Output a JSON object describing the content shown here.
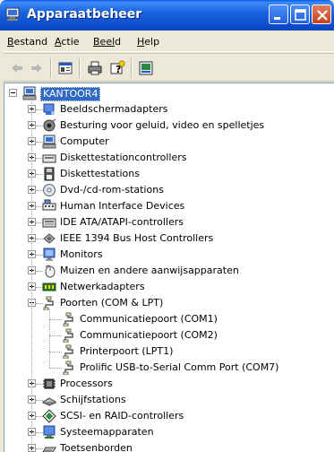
{
  "window": {
    "title": "Apparaatbeheer"
  },
  "menu": {
    "items": [
      {
        "label": "Bestand",
        "underline": "B",
        "rest": "estand"
      },
      {
        "label": "Actie",
        "underline": "A",
        "rest": "ctie"
      },
      {
        "label": "Beeld",
        "underline": "Beel",
        "rest": "d"
      },
      {
        "label": "Help",
        "underline": "H",
        "rest": "elp"
      }
    ]
  },
  "toolbar": {
    "buttons": [
      "back-icon",
      "forward-icon",
      "properties-icon",
      "print-icon",
      "help-icon",
      "update-driver-icon"
    ]
  },
  "tree": {
    "root": {
      "label": "KANTOOR4",
      "icon": "computer-icon",
      "expanded": true
    },
    "categories": [
      {
        "label": "Beeldschermadapters",
        "icon": "display-adapter-icon"
      },
      {
        "label": "Besturing voor geluid, video en spelletjes",
        "icon": "sound-icon"
      },
      {
        "label": "Computer",
        "icon": "computer-icon"
      },
      {
        "label": "Diskettestationcontrollers",
        "icon": "floppy-controller-icon"
      },
      {
        "label": "Diskettestations",
        "icon": "floppy-drive-icon"
      },
      {
        "label": "Dvd-/cd-rom-stations",
        "icon": "cdrom-icon"
      },
      {
        "label": "Human Interface Devices",
        "icon": "hid-icon"
      },
      {
        "label": "IDE ATA/ATAPI-controllers",
        "icon": "ide-controller-icon"
      },
      {
        "label": "IEEE 1394 Bus Host Controllers",
        "icon": "firewire-icon"
      },
      {
        "label": "Monitors",
        "icon": "monitor-icon"
      },
      {
        "label": "Muizen en andere aanwijsapparaten",
        "icon": "mouse-icon"
      },
      {
        "label": "Netwerkadapters",
        "icon": "network-adapter-icon"
      },
      {
        "label": "Poorten (COM & LPT)",
        "icon": "port-icon",
        "expanded": true,
        "children": [
          {
            "label": "Communicatiepoort (COM1)",
            "icon": "port-icon"
          },
          {
            "label": "Communicatiepoort (COM2)",
            "icon": "port-icon"
          },
          {
            "label": "Printerpoort (LPT1)",
            "icon": "port-icon"
          },
          {
            "label": "Prolific USB-to-Serial Comm Port (COM7)",
            "icon": "port-icon"
          }
        ]
      },
      {
        "label": "Processors",
        "icon": "processor-icon"
      },
      {
        "label": "Schijfstations",
        "icon": "disk-drive-icon"
      },
      {
        "label": "SCSI- en RAID-controllers",
        "icon": "scsi-icon"
      },
      {
        "label": "Systeemapparaten",
        "icon": "system-device-icon"
      },
      {
        "label": "Toetsenborden",
        "icon": "keyboard-icon"
      }
    ]
  },
  "colors": {
    "titlebar": "#0b4ccd",
    "selection": "#316ac5",
    "chrome": "#ece9d8"
  }
}
